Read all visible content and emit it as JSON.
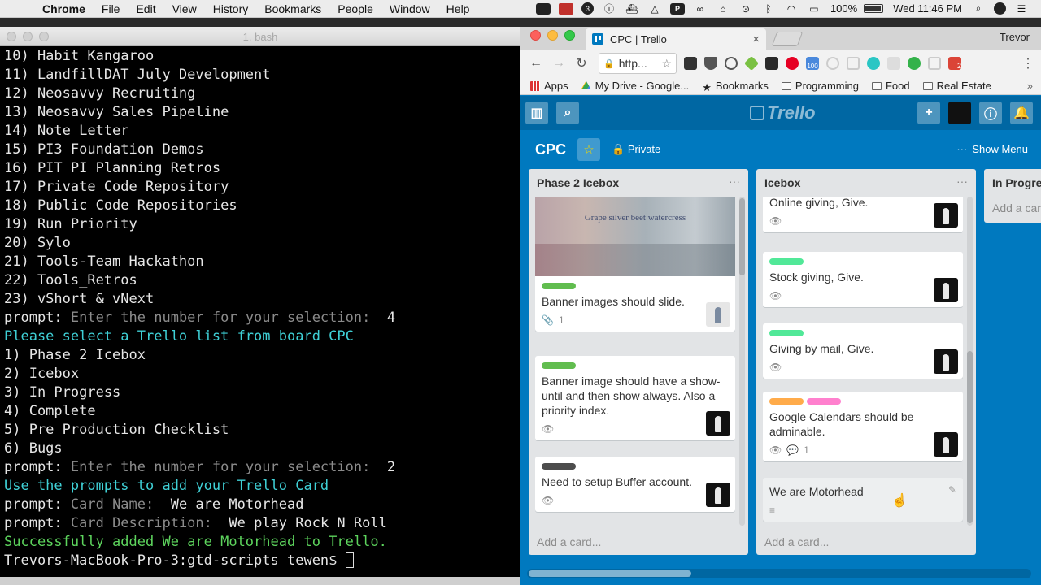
{
  "menubar": {
    "app": "Chrome",
    "items": [
      "File",
      "Edit",
      "View",
      "History",
      "Bookmarks",
      "People",
      "Window",
      "Help"
    ],
    "battery": "100%",
    "clock": "Wed 11:46 PM"
  },
  "terminal": {
    "title": "1. bash",
    "lines": [
      {
        "text": "10) Habit Kangaroo",
        "style": "normal"
      },
      {
        "text": "11) LandfillDAT July Development",
        "style": "normal"
      },
      {
        "text": "12) Neosavvy Recruiting",
        "style": "normal"
      },
      {
        "text": "13) Neosavvy Sales Pipeline",
        "style": "normal"
      },
      {
        "text": "14) Note Letter",
        "style": "normal"
      },
      {
        "text": "15) PI3 Foundation Demos",
        "style": "normal"
      },
      {
        "text": "16) PIT PI Planning Retros",
        "style": "normal"
      },
      {
        "text": "17) Private Code Repository",
        "style": "normal"
      },
      {
        "text": "18) Public Code Repositories",
        "style": "normal"
      },
      {
        "text": "19) Run Priority",
        "style": "normal"
      },
      {
        "text": "20) Sylo",
        "style": "normal"
      },
      {
        "text": "21) Tools-Team Hackathon",
        "style": "normal"
      },
      {
        "text": "22) Tools_Retros",
        "style": "normal"
      },
      {
        "text": "23) vShort & vNext",
        "style": "normal"
      },
      {
        "prefix": "prompt: ",
        "dim": "Enter the number for your selection:",
        "value": "  4",
        "style": "prompt"
      },
      {
        "text": "Please select a Trello list from board CPC",
        "style": "cyan"
      },
      {
        "text": "1) Phase 2 Icebox",
        "style": "normal"
      },
      {
        "text": "2) Icebox",
        "style": "normal"
      },
      {
        "text": "3) In Progress",
        "style": "normal"
      },
      {
        "text": "4) Complete",
        "style": "normal"
      },
      {
        "text": "5) Pre Production Checklist",
        "style": "normal"
      },
      {
        "text": "6) Bugs",
        "style": "normal"
      },
      {
        "prefix": "prompt: ",
        "dim": "Enter the number for your selection:",
        "value": "  2",
        "style": "prompt"
      },
      {
        "text": "Use the prompts to add your Trello Card",
        "style": "cyan"
      },
      {
        "prefix": "prompt: ",
        "dim": "Card Name:",
        "value": "  We are Motorhead",
        "style": "prompt"
      },
      {
        "prefix": "prompt: ",
        "dim": "Card Description:",
        "value": "  We play Rock N Roll",
        "style": "prompt"
      },
      {
        "text": "Successfully added We are Motorhead to Trello.",
        "style": "green"
      },
      {
        "text": "Trevors-MacBook-Pro-3:gtd-scripts tewen$ ",
        "style": "shell"
      }
    ]
  },
  "browser": {
    "tab_title": "CPC | Trello",
    "tab_close": "×",
    "profile": "Trevor",
    "url": "http...",
    "bookmarks": [
      "Apps",
      "My Drive - Google...",
      "Bookmarks",
      "Programming",
      "Food",
      "Real Estate"
    ],
    "ext_badge": "100",
    "mail_badge": "2"
  },
  "trello": {
    "logo": "Trello",
    "board_name": "CPC",
    "visibility": "Private",
    "show_menu": "Show Menu",
    "add_card": "Add a card...",
    "lists": [
      {
        "title": "Phase 2 Icebox",
        "cards": [
          {
            "cover_text": "Grape silver beet watercress",
            "labels": [
              "#61bd4f"
            ],
            "title": "Banner images should slide.",
            "attachments": "1",
            "member": "light"
          },
          {
            "labels": [
              "#61bd4f"
            ],
            "title": "Banner image should have a show-until and then show always. Also a priority index.",
            "watch": true,
            "member": "dark"
          },
          {
            "labels": [
              "#4d4d4d"
            ],
            "title": "Need to setup Buffer account.",
            "watch": true,
            "member": "dark"
          }
        ]
      },
      {
        "title": "Icebox",
        "cards": [
          {
            "labels": [],
            "title": "Online giving, Give.",
            "watch": true,
            "member": "dark"
          },
          {
            "labels": [
              "#51e898"
            ],
            "title": "Stock giving, Give.",
            "watch": true,
            "member": "dark"
          },
          {
            "labels": [
              "#51e898"
            ],
            "title": "Giving by mail, Give.",
            "watch": true,
            "member": "dark"
          },
          {
            "labels": [
              "#ffab4a",
              "#ff80ce"
            ],
            "title": "Google Calendars should be adminable.",
            "watch": true,
            "comments": "1",
            "member": "dark"
          },
          {
            "labels": [],
            "title": "We are Motorhead",
            "description": true
          }
        ]
      },
      {
        "title": "In Progre",
        "cards": []
      }
    ]
  }
}
